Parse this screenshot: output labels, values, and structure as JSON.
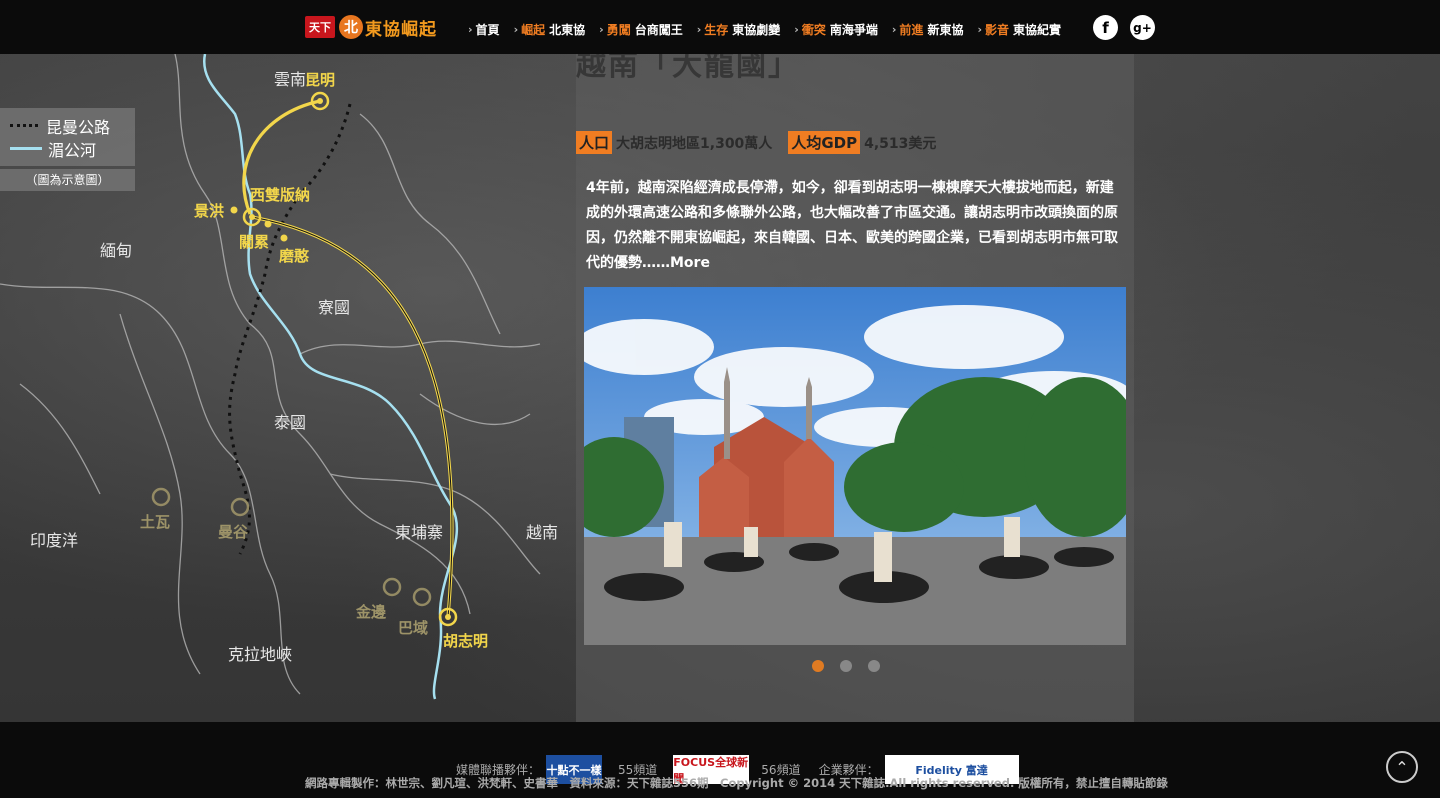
{
  "brand": {
    "badge": "天下",
    "north": "北",
    "name": "東協崛起"
  },
  "nav": [
    {
      "highlight": "",
      "label": "首頁"
    },
    {
      "highlight": "崛起",
      "label": "北東協"
    },
    {
      "highlight": "勇闖",
      "label": "台商闖王"
    },
    {
      "highlight": "生存",
      "label": "東協劇變"
    },
    {
      "highlight": "衝突",
      "label": "南海爭端"
    },
    {
      "highlight": "前進",
      "label": "新東協"
    },
    {
      "highlight": "影音",
      "label": "東協紀實"
    }
  ],
  "social": {
    "facebook": "f",
    "googleplus": "g+"
  },
  "legend": {
    "road": "昆曼公路",
    "river": "湄公河",
    "note": "（圖為示意圖）"
  },
  "map": {
    "cities_active": [
      "昆明",
      "西雙版納",
      "景洪",
      "關累",
      "磨憨",
      "胡志明"
    ],
    "cities_dim": [
      "土瓦",
      "曼谷",
      "金邊",
      "巴域"
    ],
    "regions": [
      "雲南",
      "緬甸",
      "寮國",
      "泰國",
      "東埔寨",
      "越南",
      "印度洋",
      "克拉地峽"
    ]
  },
  "article": {
    "heading": "越南「大龍國」",
    "stat1_tag": "人口",
    "stat1_val": "大胡志明地區1,300萬人",
    "stat2_tag": "人均GDP",
    "stat2_val": "4,513美元",
    "body": "4年前，越南深陷經濟成長停滯，如今，卻看到胡志明一棟棟摩天大樓拔地而起，新建成的外環高速公路和多條聯外公路，也大幅改善了市區交通。讓胡志明市改頭換面的原因，仍然離不開東協崛起，來自韓國、日本、歐美的跨國企業，已看到胡志明市無可取代的優勢……More"
  },
  "carousel": {
    "current": 1,
    "total": 3
  },
  "footer": {
    "media_label": "媒體聯播夥伴：",
    "partner1": "十點不一樣",
    "channel1": "55頻道",
    "partner2": "FOCUS全球新聞",
    "channel2": "56頻道",
    "sponsor_label": "企業夥伴：",
    "sponsor": "Fidelity 富達",
    "credits": "網路專輯製作：林世宗、劉凡瑄、洪梵軒、史書華　資料來源：天下雜誌556期　Copyright © 2014 天下雜誌.All rights reserved. 版權所有，禁止擅自轉貼節錄"
  },
  "colors": {
    "accent": "#f07d22",
    "route": "#f2d64b",
    "river": "#a6e0f0",
    "board": "#3d3d3d"
  }
}
